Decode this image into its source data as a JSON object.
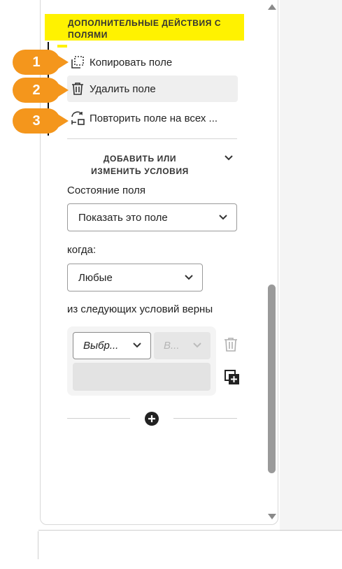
{
  "section_title": "ДОПОЛНИТЕЛЬНЫЕ ДЕЙСТВИЯ С ПОЛЯМИ",
  "actions": [
    {
      "badge": "1",
      "label": "Копировать поле",
      "icon": "copy-field-icon"
    },
    {
      "badge": "2",
      "label": "Удалить поле",
      "icon": "trash-icon"
    },
    {
      "badge": "3",
      "label": "Повторить поле на всех ...",
      "icon": "repeat-icon"
    }
  ],
  "conditions": {
    "heading": "ДОБАВИТЬ ИЛИ ИЗМЕНИТЬ УСЛОВИЯ",
    "field_state_label": "Состояние поля",
    "field_state_value": "Показать это поле",
    "when_label": "когда:",
    "when_value": "Любые",
    "match_label": "из следующих условий верны",
    "rule_field_value": "Выбр...",
    "rule_operator_value": "В..."
  },
  "colors": {
    "highlight": "#fff200",
    "badge": "#f4961c"
  }
}
